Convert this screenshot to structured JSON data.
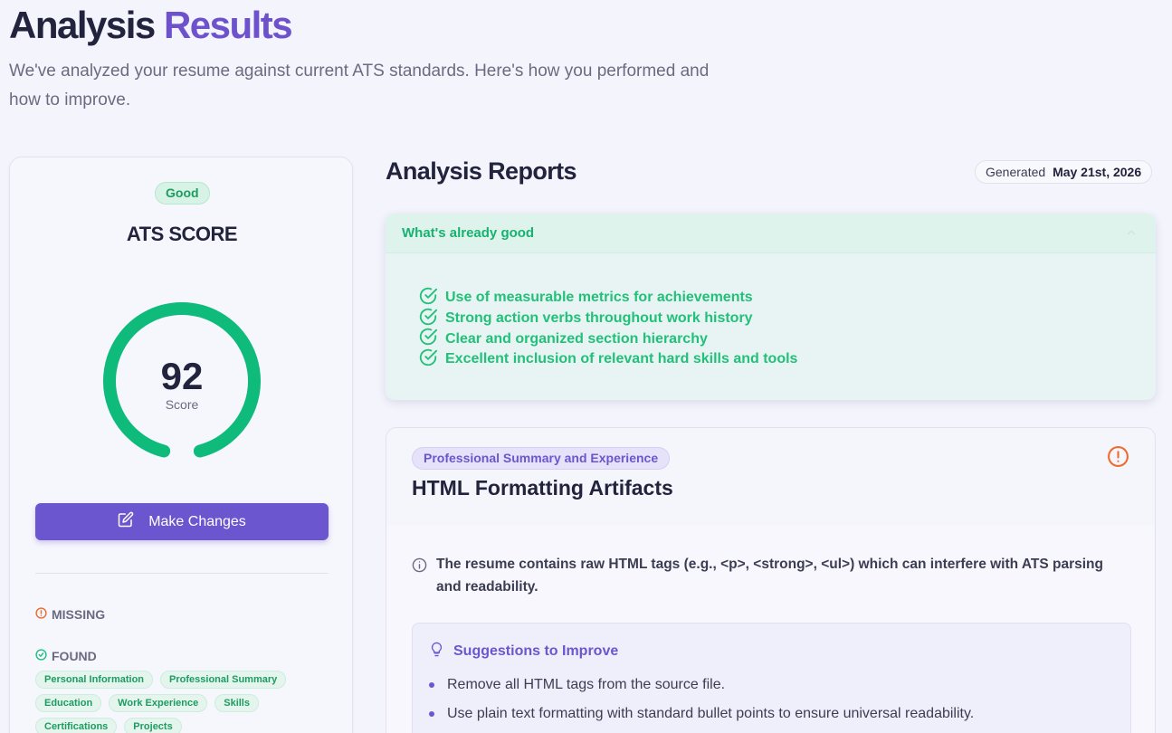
{
  "header": {
    "title_main": "Analysis",
    "title_accent": "Results",
    "subtitle": "We've analyzed your resume against current ATS standards. Here's how you performed and how to improve."
  },
  "score_card": {
    "badge": "Good",
    "title": "ATS SCORE",
    "score": "92",
    "score_fraction": 0.92,
    "score_label": "Score",
    "make_changes_label": "Make Changes",
    "missing_label": "MISSING",
    "found_label": "FOUND",
    "found_tags": [
      "Personal Information",
      "Professional Summary",
      "Education",
      "Work Experience",
      "Skills",
      "Certifications",
      "Projects"
    ]
  },
  "reports": {
    "title": "Analysis Reports",
    "generated_label": "Generated",
    "generated_date": "May 21st, 2026",
    "good_section": {
      "title": "What's already good",
      "items": [
        "Use of measurable metrics for achievements",
        "Strong action verbs throughout work history",
        "Clear and organized section hierarchy",
        "Excellent inclusion of relevant hard skills and tools"
      ]
    },
    "issue": {
      "category": "Professional Summary and Experience",
      "title": "HTML Formatting Artifacts",
      "description": "The resume contains raw HTML tags (e.g., <p>, <strong>, <ul>) which can interfere with ATS parsing and readability.",
      "suggestions_title": "Suggestions to Improve",
      "suggestions": [
        "Remove all HTML tags from the source file.",
        "Use plain text formatting with standard bullet points to ensure universal readability."
      ]
    }
  },
  "colors": {
    "accent": "#6c56cf",
    "success": "#1fbf7f",
    "warning": "#ef6a2c"
  },
  "icons": [
    "edit-icon",
    "alert-circle-icon",
    "check-circle-icon",
    "chevron-up-icon",
    "info-icon",
    "lightbulb-icon"
  ]
}
